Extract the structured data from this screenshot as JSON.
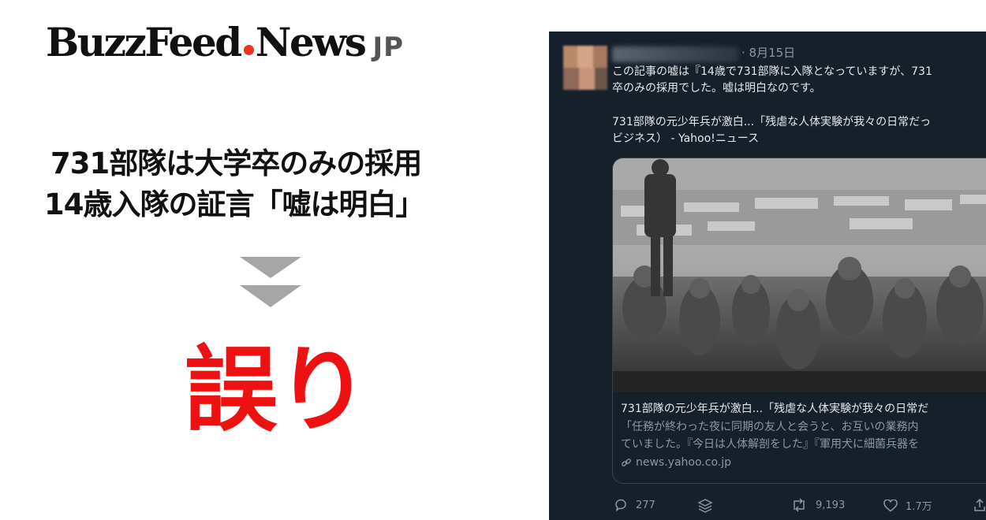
{
  "brand": {
    "main": "BuzzFeed",
    "sub": "News",
    "suffix": "JP",
    "dot_color": "#ee3322"
  },
  "claim": {
    "line1": "731部隊は大学卒のみの採用",
    "line2": "14歳入隊の証言「嘘は明白」"
  },
  "verdict": {
    "label": "誤り",
    "color": "#ee1111"
  },
  "tweet": {
    "date": "· 8月15日",
    "text_line1": "この記事の嘘は『14歳で731部隊に入隊となっていますが、731",
    "text_line2": "卒のみの採用でした。嘘は明白なのです。",
    "text_line3": "731部隊の元少年兵が激白...「残虐な人体実験が我々の日常だっ",
    "text_line4": "ビジネス） - Yahoo!ニュース",
    "card": {
      "title": "731部隊の元少年兵が激白...「残虐な人体実験が我々の日常だ",
      "desc_line1": "「任務が終わった夜に同期の友人と会うと、お互いの業務内",
      "desc_line2": "ていました。『今日は人体解剖をした』『軍用犬に細菌兵器を",
      "url": "news.yahoo.co.jp"
    },
    "actions": {
      "replies": "277",
      "retweets": "9,193",
      "likes": "1.7万"
    },
    "icons": [
      "reply-icon",
      "layers-icon",
      "retweet-icon",
      "heart-icon",
      "share-icon",
      "link-icon"
    ]
  }
}
